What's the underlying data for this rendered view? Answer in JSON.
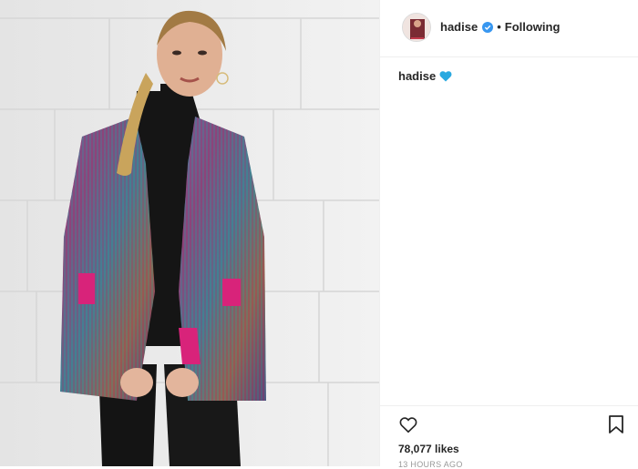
{
  "post": {
    "image_alt": "Woman in a multicolor tinsel fringe jacket and black turtleneck posing against a white brick wall"
  },
  "header": {
    "username": "hadise",
    "separator": "•",
    "follow_label": "Following"
  },
  "caption": {
    "username": "hadise"
  },
  "stats": {
    "likes": "78,077 likes",
    "time": "13 HOURS AGO"
  },
  "colors": {
    "verified": "#3897f0",
    "heart_emoji": "#2aa9e0",
    "text": "#262626",
    "muted": "#999999",
    "divider": "#efefef"
  },
  "icons": {
    "like": "heart-outline-icon",
    "save": "bookmark-icon",
    "verified": "verified-badge-icon"
  }
}
